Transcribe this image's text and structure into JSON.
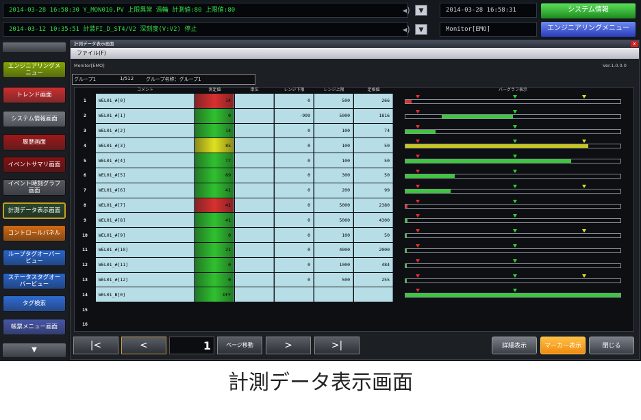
{
  "ticker": {
    "line1": "2014-03-28 16:58:30 Y_MON010.PV 上限異常 渦輪 計測値:80 上限値:80",
    "line2": "2014-03-12 10:35:51 計装FI_D_ST4/V2 深刻度(V:V2) 停止"
  },
  "header": {
    "datetime": "2014-03-28 16:58:31",
    "user": "Monitor[EMO]",
    "system_info_btn": "システム情報",
    "eng_menu_btn": "エンジニアリングメニュー",
    "dropdown_glyph": "▼",
    "speaker_glyph": "◂)"
  },
  "sidebar": {
    "items": [
      {
        "label": "エンジニアリングメニュー",
        "color": "#8ab000"
      },
      {
        "label": "トレンド画面",
        "color": "#d83030"
      },
      {
        "label": "システム情報画面",
        "color": "#7a7e86"
      },
      {
        "label": "履歴画面",
        "color": "#a81818"
      },
      {
        "label": "イベントサマリ画面",
        "color": "#8a1010"
      },
      {
        "label": "イベント時刻グラフ画面",
        "color": "#5a5e64"
      },
      {
        "label": "計測データ表示画面",
        "color": "#2a4a2a"
      },
      {
        "label": "コントロールパネル",
        "color": "#e07010"
      },
      {
        "label": "ループタグオーバービュー",
        "color": "#2a6ad8"
      },
      {
        "label": "ステータスタグオーバービュー",
        "color": "#2a6ad8"
      },
      {
        "label": "タグ検索",
        "color": "#3070e0"
      },
      {
        "label": "帳票メニュー画面",
        "color": "#4a5ab0"
      }
    ],
    "down_arrow": "▼"
  },
  "window": {
    "title": "計測データ表示画面",
    "menu_file": "ファイル(F)",
    "user": "Monitor[EMO]",
    "version": "Ver.1.0.0.0",
    "group_label": "グループ1",
    "group_page": "1/512",
    "group_name": "グループ名称：グループ1",
    "close_glyph": "x"
  },
  "table": {
    "headers": [
      "コメント",
      "測定値",
      "単位",
      "レンジ下限",
      "レンジ上限",
      "定格値",
      "バーグラフ表示"
    ],
    "rows": [
      {
        "no": "1",
        "tag": "WEL01_#[0]",
        "value": "14",
        "state": "alarm",
        "lo": "0",
        "hi": "500",
        "rated": "266",
        "fill": 0.03,
        "color": "#d83030"
      },
      {
        "no": "2",
        "tag": "WEL01_#[1]",
        "value": "0",
        "state": "ok",
        "lo": "-999",
        "hi": "5000",
        "rated": "1816",
        "fill": 0.0,
        "seg": [
          0.17,
          0.5
        ],
        "color": "#3cc83c"
      },
      {
        "no": "3",
        "tag": "WEL01_#[2]",
        "value": "14",
        "state": "ok",
        "lo": "0",
        "hi": "100",
        "rated": "74",
        "fill": 0.14,
        "color": "#3cc83c"
      },
      {
        "no": "4",
        "tag": "WEL01_#[3]",
        "value": "85",
        "state": "warn",
        "lo": "0",
        "hi": "100",
        "rated": "50",
        "fill": 0.85,
        "color": "#c8c820"
      },
      {
        "no": "5",
        "tag": "WEL01_#[4]",
        "value": "77",
        "state": "ok",
        "lo": "0",
        "hi": "100",
        "rated": "50",
        "fill": 0.77,
        "color": "#3cc83c"
      },
      {
        "no": "6",
        "tag": "WEL01_#[5]",
        "value": "69",
        "state": "ok",
        "lo": "0",
        "hi": "300",
        "rated": "50",
        "fill": 0.23,
        "color": "#3cc83c"
      },
      {
        "no": "7",
        "tag": "WEL01_#[6]",
        "value": "41",
        "state": "ok",
        "lo": "0",
        "hi": "200",
        "rated": "99",
        "fill": 0.21,
        "color": "#3cc83c"
      },
      {
        "no": "8",
        "tag": "WEL01_#[7]",
        "value": "41",
        "state": "alarm",
        "lo": "0",
        "hi": "5000",
        "rated": "2380",
        "fill": 0.008,
        "color": "#d83030"
      },
      {
        "no": "9",
        "tag": "WEL01_#[8]",
        "value": "41",
        "state": "ok",
        "lo": "0",
        "hi": "5000",
        "rated": "4300",
        "fill": 0.008,
        "color": "#3cc83c"
      },
      {
        "no": "10",
        "tag": "WEL01_#[9]",
        "value": "0",
        "state": "ok",
        "lo": "0",
        "hi": "100",
        "rated": "50",
        "fill": 0.0,
        "color": "#3cc83c"
      },
      {
        "no": "11",
        "tag": "WEL01_#[10]",
        "value": "21",
        "state": "ok",
        "lo": "0",
        "hi": "4000",
        "rated": "2000",
        "fill": 0.005,
        "color": "#3cc83c"
      },
      {
        "no": "12",
        "tag": "WEL01_#[11]",
        "value": "0",
        "state": "ok",
        "lo": "0",
        "hi": "1000",
        "rated": "484",
        "fill": 0.0,
        "color": "#3cc83c"
      },
      {
        "no": "13",
        "tag": "WEL01_#[12]",
        "value": "0",
        "state": "ok",
        "lo": "0",
        "hi": "500",
        "rated": "255",
        "fill": 0.0,
        "color": "#3cc83c"
      },
      {
        "no": "14",
        "tag": "WEL01_B[0]",
        "value": "OFF",
        "state": "ok",
        "lo": "",
        "hi": "",
        "rated": "",
        "fill": 1.0,
        "color": "#3cc83c"
      },
      {
        "no": "15",
        "tag": "",
        "value": "",
        "state": "empty",
        "lo": "",
        "hi": "",
        "rated": "",
        "fill": 0,
        "color": ""
      },
      {
        "no": "16",
        "tag": "",
        "value": "",
        "state": "empty",
        "lo": "",
        "hi": "",
        "rated": "",
        "fill": 0,
        "color": ""
      }
    ]
  },
  "nav": {
    "first": "|<",
    "prev": "<",
    "page": "1",
    "goto": "ページ移動",
    "next": ">",
    "last": ">|"
  },
  "bottom": {
    "detail": "詳細表示",
    "marker": "マーカー表示",
    "close": "閉じる"
  },
  "caption": "計測データ表示画面",
  "colors": {
    "alarm": "#d83030",
    "warn": "#e0e020",
    "ok": "#30c030",
    "cell": "#b7dde6"
  }
}
